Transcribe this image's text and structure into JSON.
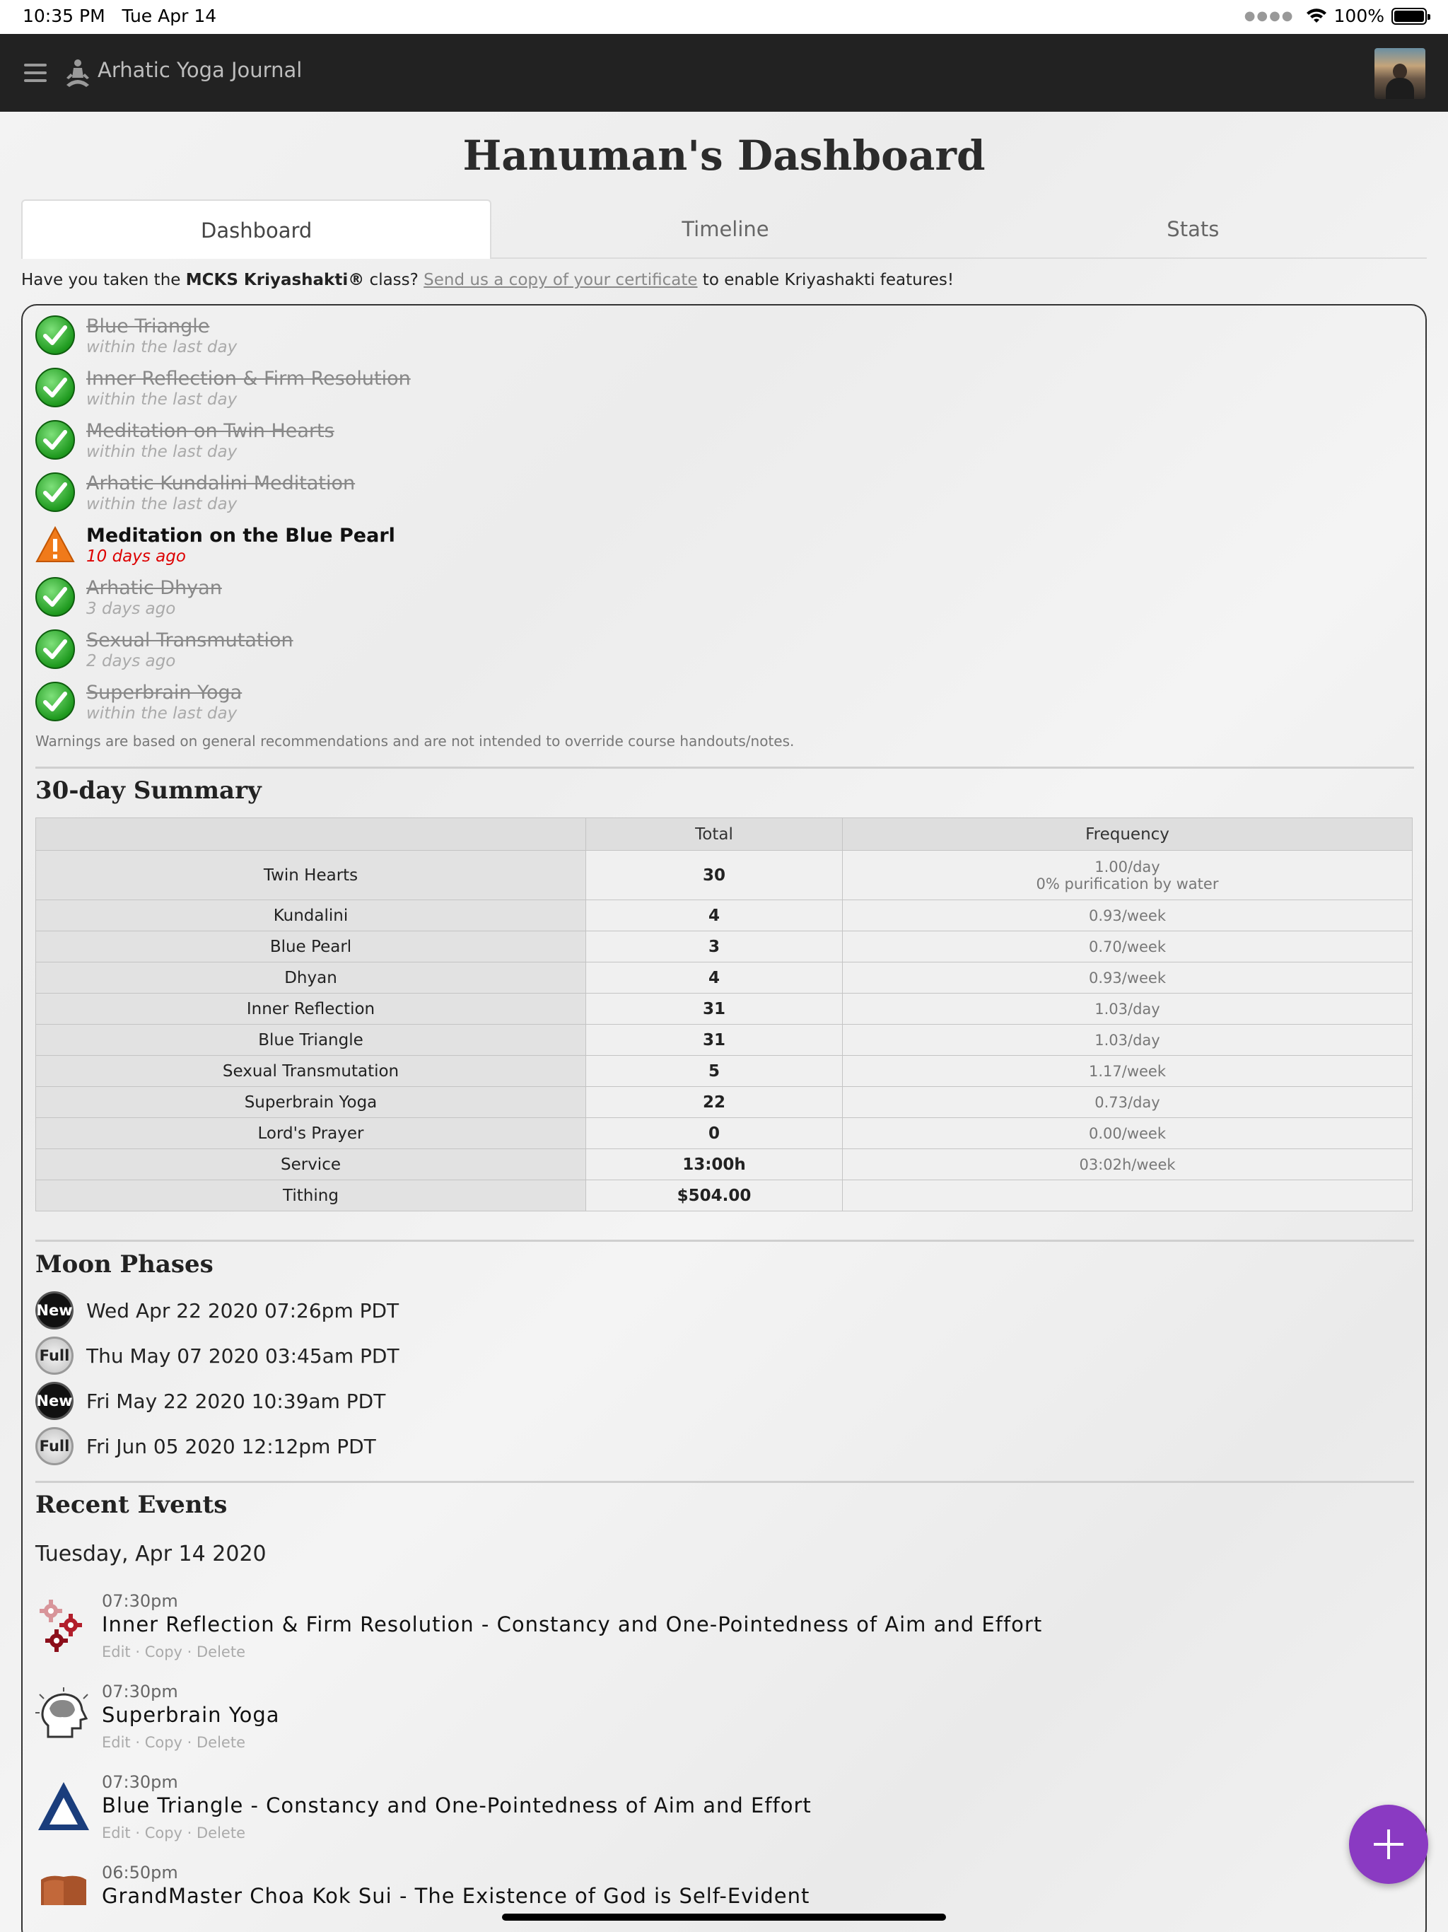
{
  "status": {
    "time": "10:35 PM",
    "date": "Tue Apr 14",
    "battery": "100%"
  },
  "nav": {
    "brand": "Arhatic Yoga Journal"
  },
  "page_title": "Hanuman's Dashboard",
  "tabs": [
    {
      "label": "Dashboard",
      "active": true
    },
    {
      "label": "Timeline",
      "active": false
    },
    {
      "label": "Stats",
      "active": false
    }
  ],
  "notice": {
    "prefix": "Have you taken the ",
    "bold": "MCKS Kriyashakti®",
    "mid": " class? ",
    "link": "Send us a copy of your certificate",
    "suffix": " to enable Kriyashakti features!"
  },
  "checklist": [
    {
      "title": "Blue Triangle",
      "sub": "within the last day",
      "status": "done"
    },
    {
      "title": "Inner Reflection & Firm Resolution",
      "sub": "within the last day",
      "status": "done"
    },
    {
      "title": "Meditation on Twin Hearts",
      "sub": "within the last day",
      "status": "done"
    },
    {
      "title": "Arhatic Kundalini Meditation",
      "sub": "within the last day",
      "status": "done"
    },
    {
      "title": "Meditation on the Blue Pearl",
      "sub": "10 days ago",
      "status": "warning"
    },
    {
      "title": "Arhatic Dhyan",
      "sub": "3 days ago",
      "status": "done"
    },
    {
      "title": "Sexual Transmutation",
      "sub": "2 days ago",
      "status": "done"
    },
    {
      "title": "Superbrain Yoga",
      "sub": "within the last day",
      "status": "done"
    }
  ],
  "disclaimer": "Warnings are based on general recommendations and are not intended to override course handouts/notes.",
  "summary": {
    "heading": "30-day Summary",
    "columns": [
      "",
      "Total",
      "Frequency"
    ],
    "rows": [
      {
        "name": "Twin Hearts",
        "total": "30",
        "freq": "1.00/day",
        "freq2": "0% purification by water"
      },
      {
        "name": "Kundalini",
        "total": "4",
        "freq": "0.93/week"
      },
      {
        "name": "Blue Pearl",
        "total": "3",
        "freq": "0.70/week"
      },
      {
        "name": "Dhyan",
        "total": "4",
        "freq": "0.93/week"
      },
      {
        "name": "Inner Reflection",
        "total": "31",
        "freq": "1.03/day"
      },
      {
        "name": "Blue Triangle",
        "total": "31",
        "freq": "1.03/day"
      },
      {
        "name": "Sexual Transmutation",
        "total": "5",
        "freq": "1.17/week"
      },
      {
        "name": "Superbrain Yoga",
        "total": "22",
        "freq": "0.73/day"
      },
      {
        "name": "Lord's Prayer",
        "total": "0",
        "freq": "0.00/week"
      },
      {
        "name": "Service",
        "total": "13:00h",
        "freq": "03:02h/week"
      },
      {
        "name": "Tithing",
        "total": "$504.00",
        "freq": ""
      }
    ]
  },
  "moon": {
    "heading": "Moon Phases",
    "items": [
      {
        "phase": "New",
        "text": "Wed Apr 22 2020 07:26pm PDT"
      },
      {
        "phase": "Full",
        "text": "Thu May 07 2020 03:45am PDT"
      },
      {
        "phase": "New",
        "text": "Fri May 22 2020 10:39am PDT"
      },
      {
        "phase": "Full",
        "text": "Fri Jun 05 2020 12:12pm PDT"
      }
    ]
  },
  "recent": {
    "heading": "Recent Events",
    "date": "Tuesday, Apr 14 2020",
    "actions": "Edit · Copy · Delete",
    "events": [
      {
        "time": "07:30pm",
        "title": "Inner Reflection & Firm Resolution - Constancy and One-Pointedness of Aim and Effort",
        "icon": "gears-icon"
      },
      {
        "time": "07:30pm",
        "title": "Superbrain Yoga",
        "icon": "brain-head-icon"
      },
      {
        "time": "07:30pm",
        "title": "Blue Triangle - Constancy and One-Pointedness of Aim and Effort",
        "icon": "triangle-icon"
      },
      {
        "time": "06:50pm",
        "title": "GrandMaster Choa Kok Sui - The Existence of God is Self-Evident",
        "icon": "book-icon"
      }
    ]
  },
  "colors": {
    "accent": "#8a3ac2",
    "navbar": "#222222",
    "warning": "#dd0000"
  }
}
